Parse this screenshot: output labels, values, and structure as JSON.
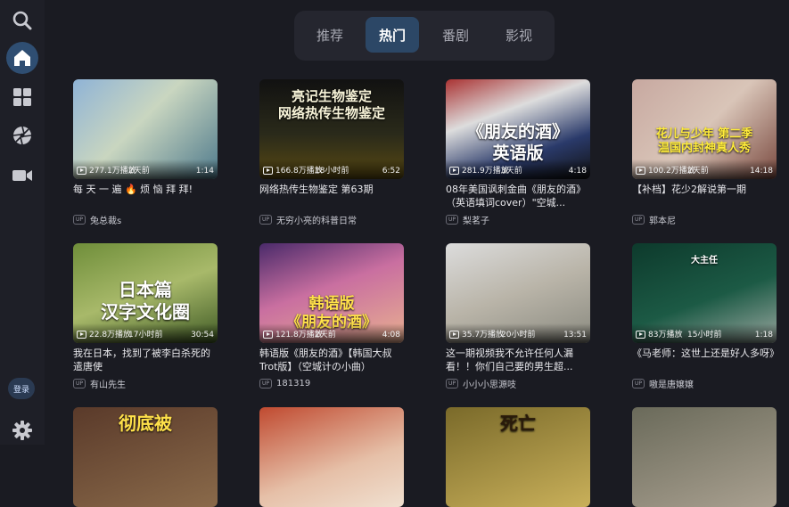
{
  "sidebar": {
    "login_label": "登录",
    "icons": [
      "search-icon",
      "home-icon",
      "grid-icon",
      "aperture-icon",
      "video-camera-icon",
      "gear-icon"
    ]
  },
  "tabs": [
    {
      "label": "推荐",
      "active": false
    },
    {
      "label": "热门",
      "active": true
    },
    {
      "label": "番剧",
      "active": false
    },
    {
      "label": "影视",
      "active": false
    }
  ],
  "videos": [
    {
      "plays": "277.1万播放",
      "ago": "2天前",
      "duration": "1:14",
      "title": "每 天 一 遍 🔥 烦 恼 拜 拜!",
      "uploader": "兔总裁s",
      "thumb_text": ""
    },
    {
      "plays": "166.8万播放",
      "ago": "18小时前",
      "duration": "6:52",
      "title": "网络热传生物鉴定 第63期",
      "uploader": "无穷小亮的科普日常",
      "thumb_text": "亮记生物鉴定\n网络热传生物鉴定"
    },
    {
      "plays": "281.9万播放",
      "ago": "3天前",
      "duration": "4:18",
      "title": "08年美国讽刺金曲《朋友的酒》（英语填词cover）\"空城...",
      "uploader": "梨茗子",
      "thumb_text": "《朋友的酒》\n英语版"
    },
    {
      "plays": "100.2万播放",
      "ago": "2天前",
      "duration": "14:18",
      "title": "【补档】花少2解说第一期",
      "uploader": "郭本尼",
      "thumb_text": "花儿与少年 第二季\n温国内封神真人秀"
    },
    {
      "plays": "22.8万播放",
      "ago": "17小时前",
      "duration": "30:54",
      "title": "我在日本，找到了被李白杀死的遣唐使",
      "uploader": "有山先生",
      "thumb_text": "日本篇\n汉字文化圈"
    },
    {
      "plays": "121.8万播放",
      "ago": "2天前",
      "duration": "4:08",
      "title": "韩语版《朋友的酒》【韩国大叔Trot版】（空城计の小曲）",
      "uploader": "181319",
      "thumb_text": "韩语版\n《朋友的酒》"
    },
    {
      "plays": "35.7万播放",
      "ago": "20小时前",
      "duration": "13:51",
      "title": "这一期视频我不允许任何人漏看！！你们自己要的男生超...",
      "uploader": "小小小思源吱",
      "thumb_text": ""
    },
    {
      "plays": "83万播放",
      "ago": "15小时前",
      "duration": "1:18",
      "title": "《马老师：这世上还是好人多呀》",
      "uploader": "嗷是唐嬢嬢",
      "thumb_text": "大主任"
    },
    {
      "plays": "",
      "ago": "",
      "duration": "",
      "title": "",
      "uploader": "",
      "thumb_text": "彻底被"
    },
    {
      "plays": "",
      "ago": "",
      "duration": "",
      "title": "",
      "uploader": "",
      "thumb_text": ""
    },
    {
      "plays": "",
      "ago": "",
      "duration": "",
      "title": "",
      "uploader": "",
      "thumb_text": "死亡"
    },
    {
      "plays": "",
      "ago": "",
      "duration": "",
      "title": "",
      "uploader": "",
      "thumb_text": ""
    }
  ]
}
